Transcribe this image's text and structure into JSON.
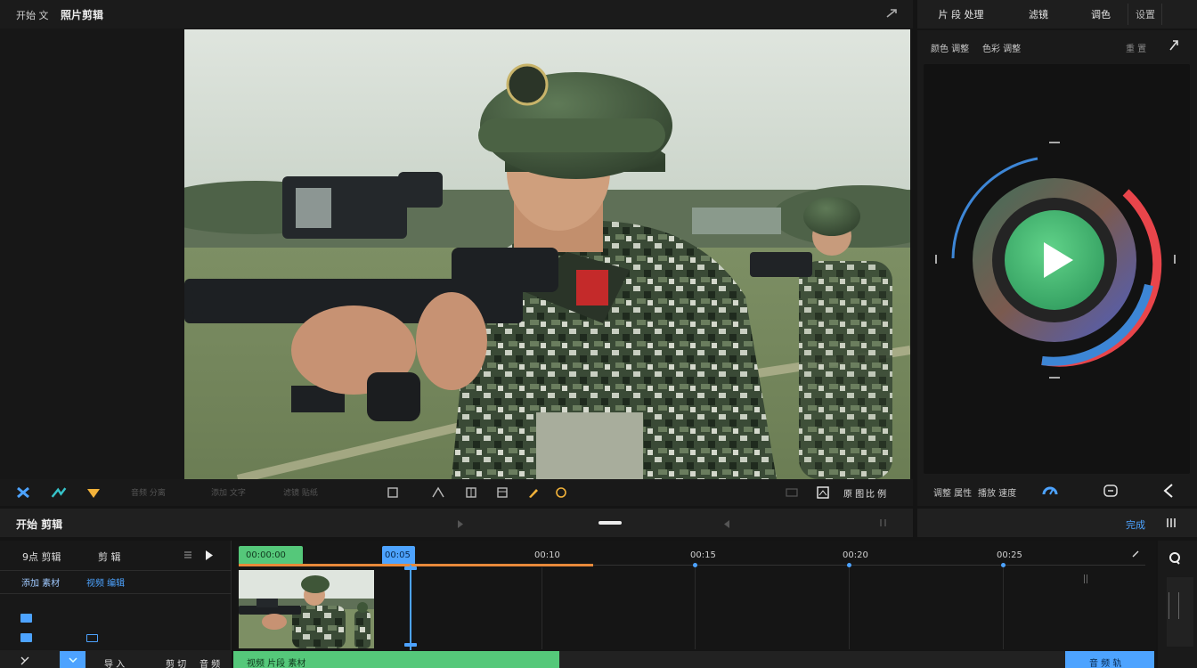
{
  "app": {
    "menu_label": "开始 文",
    "title": "照片剪辑",
    "top_icon": "pin-icon"
  },
  "right_tabs": [
    {
      "label": "片 段 处理"
    },
    {
      "label": "滤镜"
    },
    {
      "label": "调色"
    },
    {
      "label": "设置"
    }
  ],
  "right_panel": {
    "sub_tabs": [
      "颜色 调整",
      "色彩 调整"
    ],
    "sub_right": "重 置",
    "bottom_labels": [
      "调整 属性",
      "播放 速度"
    ],
    "play_button_label": "Play"
  },
  "toolbar": {
    "left_icons": [
      "scissors-icon",
      "magic-icon",
      "color-icon"
    ],
    "labels": [
      "音频 分离",
      "添加 文字",
      "滤镜 贴纸"
    ],
    "center_icons": [
      "crop-icon",
      "split-icon",
      "frame-icon",
      "fit-icon",
      "pen-icon",
      "filter-icon"
    ],
    "right_icons": [
      "aspect-icon",
      "screenshot-icon"
    ],
    "right_labels": [
      "原 图",
      "比 例"
    ]
  },
  "project_bar": {
    "title": "开始 剪辑",
    "right_label": "完成"
  },
  "timeline_left": {
    "row1": [
      "9点 剪辑",
      "剪 辑"
    ],
    "row2": [
      "添加 素材",
      "视频 编辑"
    ],
    "bottom": [
      "导 入",
      "剪 切",
      "音 频"
    ]
  },
  "timeline": {
    "ruler": [
      {
        "label": "00:00:00"
      },
      {
        "label": "00:05"
      },
      {
        "label": "00:10"
      },
      {
        "label": "00:15"
      },
      {
        "label": "00:20"
      },
      {
        "label": "00:25"
      }
    ],
    "clip_green_label": "视频 片段 素材",
    "clip_blue_label": "音 频 轨"
  },
  "colors": {
    "accent_green": "#55c87a",
    "accent_blue": "#4da3ff",
    "accent_orange": "#e8893a",
    "wheel_red": "#e8454b"
  }
}
